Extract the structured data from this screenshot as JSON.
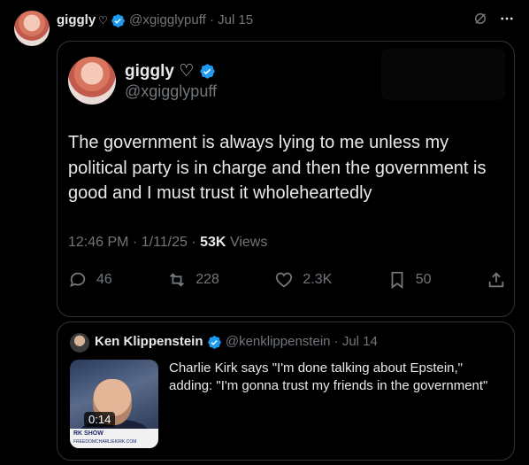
{
  "post": {
    "name": "giggly",
    "heart": "♡",
    "handle": "@xgigglypuff",
    "sep": "·",
    "date": "Jul 15"
  },
  "embedded": {
    "name": "giggly ♡",
    "handle": "@xgigglypuff",
    "text": "The government is always lying to me unless my political party is in charge and then the government is good and I must trust it wholeheartedly",
    "time_date": "12:46 PM · 1/11/25 ·",
    "views_count": "53K",
    "views_label": "Views",
    "actions": {
      "replies": "46",
      "reposts": "228",
      "likes": "2.3K",
      "bookmarks": "50"
    }
  },
  "quoted": {
    "name": "Ken Klippenstein",
    "handle": "@kenklippenstein",
    "sep": "·",
    "date": "Jul 14",
    "text": "Charlie Kirk says \"I'm done talking about Epstein,\" adding: \"I'm gonna trust my friends in the government\"",
    "video_duration": "0:14",
    "thumb_banner": "RK SHOW",
    "thumb_banner_sub": "FREEDOMCHARLIEKIRK.COM"
  },
  "colors": {
    "background": "#000000",
    "text": "#e7e9ea",
    "muted": "#71767b",
    "verified": "#1d9bf0",
    "border": "#2f3336"
  },
  "icons": [
    "grok-icon",
    "more-icon",
    "verified-icon",
    "reply-icon",
    "repost-icon",
    "like-icon",
    "bookmark-icon",
    "share-icon"
  ]
}
